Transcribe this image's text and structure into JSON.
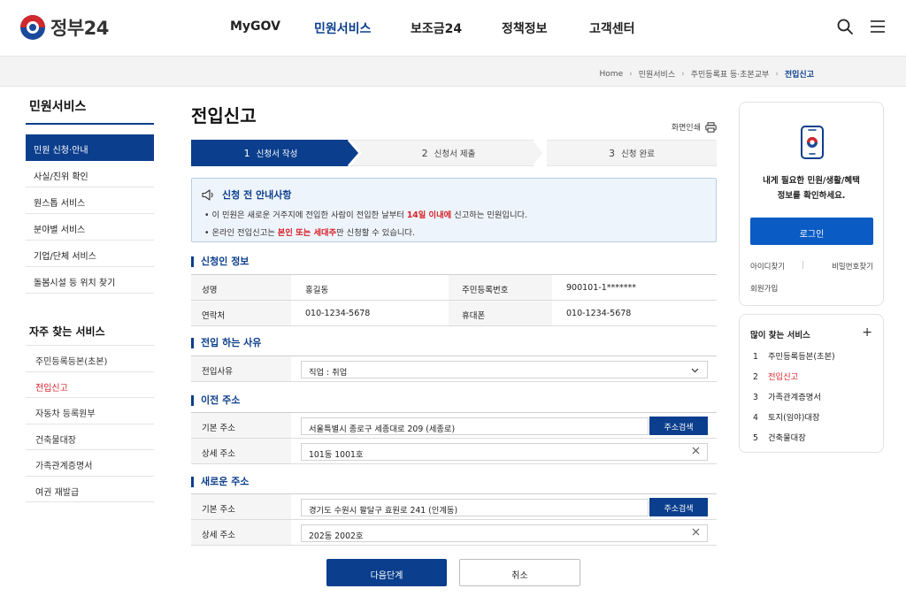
{
  "header": {
    "logo_text": "정부24",
    "nav": [
      "MyGOV",
      "민원서비스",
      "보조금24",
      "정책정보",
      "고객센터"
    ],
    "nav_active_index": 1
  },
  "breadcrumb": [
    "Home",
    "민원서비스",
    "주민등록표 등·초본교부",
    "전입신고"
  ],
  "sidebar": {
    "title": "민원서비스",
    "menu": [
      "민원 신청·안내",
      "사실/진위 확인",
      "원스톱 서비스",
      "분야별 서비스",
      "기업/단체 서비스",
      "돌봄시설 등 위치 찾기"
    ],
    "frequent_title": "자주 찾는 서비스",
    "frequent": [
      "주민등록등본(초본)",
      "전입신고",
      "자동차 등록원부",
      "건축물대장",
      "가족관계증명서",
      "여권 재발급"
    ]
  },
  "main": {
    "title": "전입신고",
    "print_label": "화면인쇄",
    "steps": [
      {
        "num": "1",
        "label": "신청서 작성"
      },
      {
        "num": "2",
        "label": "신청서 제출"
      },
      {
        "num": "3",
        "label": "신청 완료"
      }
    ],
    "notice": {
      "title": "신청 전 안내사항",
      "line1_pre": "• 이 민원은 새로운 거주지에 전입한 사람이 전입한 날부터 ",
      "line1_hl": "14일 이내에",
      "line1_post": " 신고하는 민원입니다.",
      "line2_pre": "• 온라인 전입신고는 ",
      "line2_hl": "본인 또는 세대주",
      "line2_post": "만 신청할 수 있습니다."
    },
    "applicant": {
      "title": "신청인 정보",
      "name_label": "성명",
      "name_value": "홍길동",
      "rrn_label": "주민등록번호",
      "rrn_value": "900101-1*******",
      "contact_label": "연락처",
      "contact_value": "010-1234-5678",
      "mobile_label": "휴대폰",
      "mobile_value": "010-1234-5678"
    },
    "reason": {
      "title": "전입 하는 사유",
      "label": "전입사유",
      "value": "직업 : 취업"
    },
    "old_address": {
      "title": "이전 주소",
      "base_label": "기본 주소",
      "base_value": "서울특별시 종로구 세종대로 209 (세종로)",
      "search_label": "주소검색",
      "detail_label": "상세 주소",
      "detail_value": "101동 1001호"
    },
    "new_address": {
      "title": "새로운 주소",
      "base_label": "기본 주소",
      "base_value": "경기도 수원시 팔달구 효원로 241 (인계동)",
      "search_label": "주소검색",
      "detail_label": "상세 주소",
      "detail_value": "202동 2002호"
    },
    "next_label": "다음단계",
    "cancel_label": "취소"
  },
  "login_card": {
    "message_line1": "내게 필요한 민원/생활/혜택",
    "message_line2": "정보를 확인하세요.",
    "login_label": "로그인",
    "find_id": "아이디찾기",
    "find_pw": "비밀번호찾기",
    "signup": "회원가입"
  },
  "popular": {
    "title": "많이 찾는 서비스",
    "plus": "+",
    "items": [
      {
        "n": "1",
        "t": "주민등록등본(초본)"
      },
      {
        "n": "2",
        "t": "전입신고"
      },
      {
        "n": "3",
        "t": "가족관계증명서"
      },
      {
        "n": "4",
        "t": "토지(임야)대장"
      },
      {
        "n": "5",
        "t": "건축물대장"
      }
    ],
    "active_index": 1
  },
  "colors": {
    "primary": "#0b3e8c",
    "login_button": "#0b5bc4",
    "highlight_red": "#d8232a"
  }
}
